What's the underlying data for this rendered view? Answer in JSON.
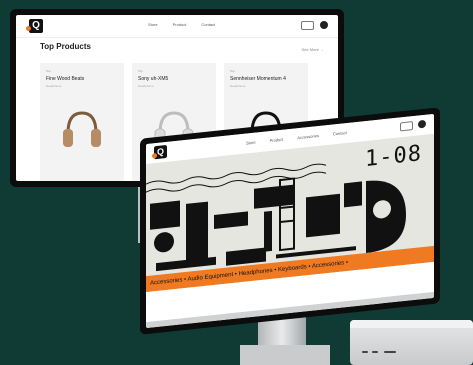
{
  "back_site": {
    "nav_links": [
      "Store",
      "Product",
      "Contact"
    ],
    "section_title": "Top Products",
    "see_all": "See More →",
    "products": [
      {
        "tag": "Top",
        "name": "Fine Wood Beats",
        "category": "Headphone",
        "color": "#b58c63"
      },
      {
        "tag": "Top",
        "name": "Sony uh-XM5",
        "category": "Headphone",
        "color": "#dcdcdc"
      },
      {
        "tag": "Top",
        "name": "Sennheiser Momentum 4",
        "category": "Headphone",
        "color": "#2b2b2b"
      }
    ]
  },
  "front_site": {
    "nav_links": [
      "Store",
      "Product",
      "Accessories",
      "Contact"
    ],
    "hero_text": "1-08",
    "ticker": "Accessories • Audio Equipment • Headphones • Keyboards • Accessories •"
  },
  "colors": {
    "background": "#0f3b34",
    "accent": "#f07a22"
  }
}
